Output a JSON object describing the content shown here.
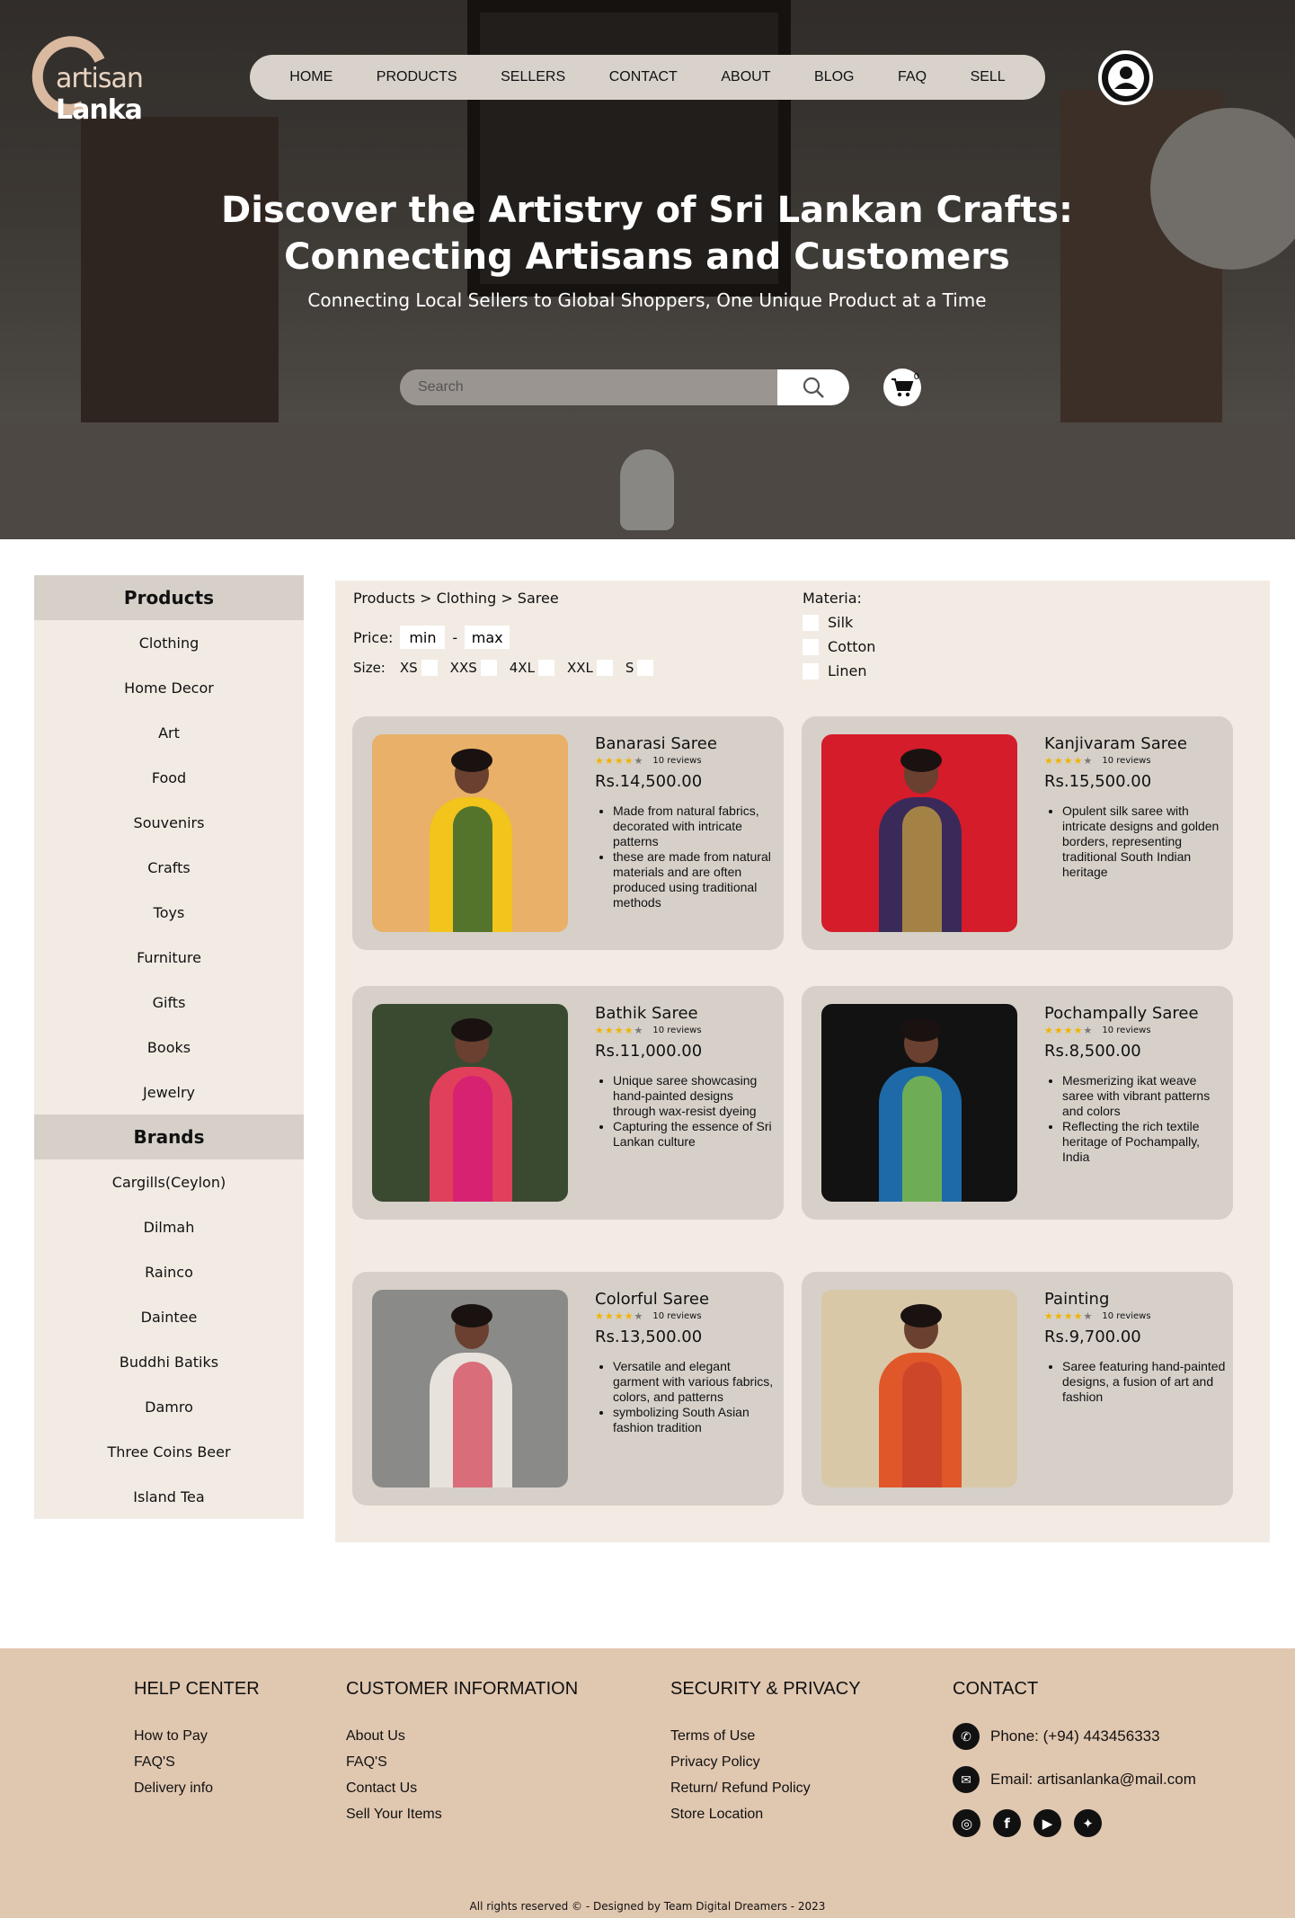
{
  "brand": {
    "logo_text_a": "artisan",
    "logo_text_b": "Lanka"
  },
  "nav": [
    "HOME",
    "PRODUCTS",
    "SELLERS",
    "CONTACT",
    "ABOUT",
    "BLOG",
    "FAQ",
    "SELL"
  ],
  "hero": {
    "title": "Discover the Artistry of Sri Lankan Crafts: Connecting Artisans and Customers",
    "subtitle": "Connecting Local Sellers to Global Shoppers, One Unique Product at a Time",
    "search_placeholder": "Search",
    "cart_count": "0"
  },
  "sidebar": {
    "products_title": "Products",
    "products": [
      "Clothing",
      "Home Decor",
      "Art",
      "Food",
      "Souvenirs",
      "Crafts",
      "Toys",
      "Furniture",
      "Gifts",
      "Books",
      "Jewelry"
    ],
    "brands_title": "Brands",
    "brands": [
      "Cargills(Ceylon)",
      "Dilmah",
      "Rainco",
      "Daintee",
      "Buddhi Batiks",
      "Damro",
      "Three Coins Beer",
      "Island Tea"
    ]
  },
  "filters": {
    "breadcrumb": "Products > Clothing > Saree",
    "price_label": "Price:",
    "price_min": "min",
    "price_sep": "-",
    "price_max": "max",
    "size_label": "Size:",
    "sizes": [
      "XS",
      "XXS",
      "4XL",
      "XXL",
      "S"
    ],
    "material_label": "Materia:",
    "materials": [
      "Silk",
      "Cotton",
      "Linen"
    ]
  },
  "products": [
    {
      "name": "Banarasi Saree",
      "rating": 4,
      "reviews": "10 reviews",
      "price": "Rs.14,500.00",
      "desc": [
        "Made from natural fabrics, decorated with intricate patterns",
        "these are made from natural materials and are often produced using traditional methods"
      ],
      "bg": "#e8b068",
      "body": "#f2c41c",
      "accent": "#1d5a2f"
    },
    {
      "name": "Kanjivaram Saree",
      "rating": 4,
      "reviews": "10 reviews",
      "price": "Rs.15,500.00",
      "desc": [
        "Opulent silk saree with intricate designs and golden borders, representing traditional South Indian heritage"
      ],
      "bg": "#d41c2a",
      "body": "#3a2a5a",
      "accent": "#c8a040"
    },
    {
      "name": "Bathik Saree",
      "rating": 4,
      "reviews": "10 reviews",
      "price": "Rs.11,000.00",
      "desc": [
        "Unique saree showcasing hand-painted designs through wax-resist dyeing",
        "Capturing the essence of Sri Lankan culture"
      ],
      "bg": "#3a4a30",
      "body": "#e0405a",
      "accent": "#d4177a"
    },
    {
      "name": "Pochampally Saree",
      "rating": 4,
      "reviews": "10 reviews",
      "price": "Rs.8,500.00",
      "desc": [
        "Mesmerizing ikat weave saree with vibrant patterns and colors",
        "Reflecting the rich textile heritage of Pochampally, India"
      ],
      "bg": "#121212",
      "body": "#1e6aa8",
      "accent": "#8ac43a"
    },
    {
      "name": "Colorful Saree",
      "rating": 4,
      "reviews": "10 reviews",
      "price": "Rs.13,500.00",
      "desc": [
        "Versatile and elegant garment with various fabrics, colors, and patterns",
        "symbolizing South Asian fashion tradition"
      ],
      "bg": "#8a8a88",
      "body": "#e8e2dc",
      "accent": "#d4455a"
    },
    {
      "name": "Painting",
      "rating": 4,
      "reviews": "10 reviews",
      "price": "Rs.9,700.00",
      "desc": [
        "Saree featuring hand-painted designs, a fusion of art and fashion"
      ],
      "bg": "#d8c8a8",
      "body": "#e0582a",
      "accent": "#c8402a"
    }
  ],
  "footer": {
    "help": {
      "title": "HELP CENTER",
      "links": [
        "How to Pay",
        "FAQ'S",
        "Delivery info"
      ]
    },
    "customer": {
      "title": "CUSTOMER INFORMATION",
      "links": [
        "About Us",
        "FAQ'S",
        "Contact Us",
        "Sell Your Items"
      ]
    },
    "security": {
      "title": "SECURITY & PRIVACY",
      "links": [
        "Terms of Use",
        "Privacy Policy",
        "Return/ Refund Policy",
        "Store Location"
      ]
    },
    "contact": {
      "title": "CONTACT",
      "phone": "Phone: (+94) 443456333",
      "email": "Email: artisanlanka@mail.com",
      "social": [
        "instagram-icon",
        "facebook-icon",
        "youtube-icon",
        "twitter-icon"
      ]
    },
    "copyright": "All rights reserved © - Designed by Team Digital Dreamers - 2023"
  },
  "colors": {
    "accent": "#e0c7b0",
    "panel": "#f2ebe3",
    "card": "#d6d0c9",
    "star": "#f0b400"
  }
}
